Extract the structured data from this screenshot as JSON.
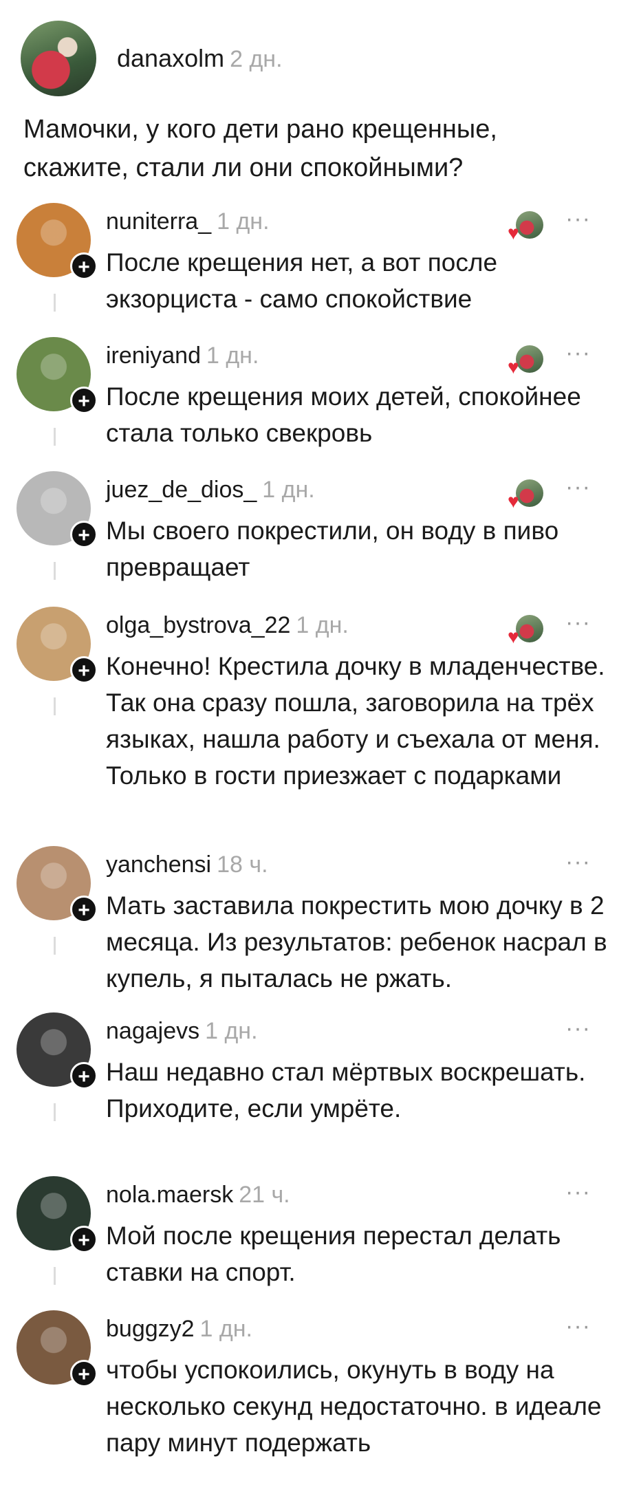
{
  "post": {
    "username": "danaxolm",
    "time": "2 дн.",
    "text": "Мамочки, у кого дети рано крещенные, скажите, стали ли они спокойными?"
  },
  "comments": [
    {
      "username": "nuniterra_",
      "time": "1 дн.",
      "text": "После крещения нет, а вот после экзорциста - само спокойствие",
      "creator_liked": true,
      "avatar_color": "#c9803a"
    },
    {
      "username": "ireniyand",
      "time": "1 дн.",
      "text": "После крещения моих детей, спокойнее стала только свекровь",
      "creator_liked": true,
      "avatar_color": "#6a8a4a"
    },
    {
      "username": "juez_de_dios_",
      "time": "1 дн.",
      "text": "Мы своего покрестили, он воду в пиво превращает",
      "creator_liked": true,
      "avatar_color": "#b8b8b8"
    },
    {
      "username": "olga_bystrova_22",
      "time": "1 дн.",
      "text": "Конечно! Крестила дочку в младенчестве. Так она сразу пошла, заговорила на трёх языках, нашла работу и съехала от меня. Только в гости приезжает с подарками",
      "creator_liked": true,
      "avatar_color": "#c8a070"
    },
    {
      "username": "yanchensi",
      "time": "18 ч.",
      "text": "Мать заставила покрестить мою дочку в 2 месяца. Из результатов: ребенок насрал в купель, я пыталась не ржать.",
      "creator_liked": false,
      "avatar_color": "#b89070"
    },
    {
      "username": "nagajevs",
      "time": "1 дн.",
      "text": "Наш недавно стал мёртвых воскрешать. Приходите, если умрёте.",
      "creator_liked": false,
      "avatar_color": "#3a3a3a"
    },
    {
      "username": "nola.maersk",
      "time": "21 ч.",
      "text": "Мой после крещения перестал делать ставки на спорт.",
      "creator_liked": false,
      "avatar_color": "#2a3a30"
    },
    {
      "username": "buggzy2",
      "time": "1 дн.",
      "text": "чтобы успокоились, окунуть в воду на несколько секунд недостаточно. в идеале пару минут подержать",
      "creator_liked": false,
      "avatar_color": "#7a5a40"
    }
  ],
  "icons": {
    "more": "more-horizontal-icon",
    "follow": "plus-icon",
    "creator_like": "heart-icon"
  },
  "labels": {
    "more_glyph": "···",
    "plus_glyph": "+",
    "heart_glyph": "♥"
  }
}
